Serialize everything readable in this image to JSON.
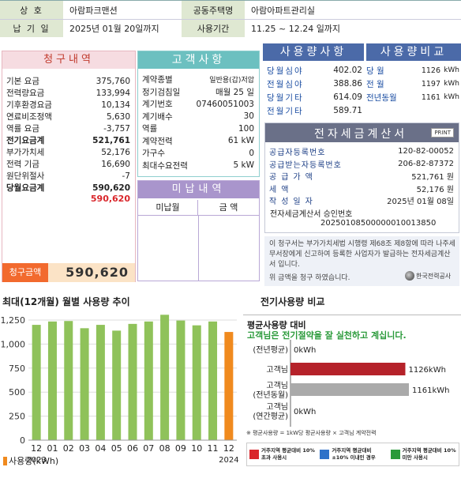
{
  "header": {
    "company_label": "상 호",
    "company_value": "아람파크맨션",
    "housing_label": "공동주택명",
    "housing_value": "아람아파트관리실",
    "due_label": "납 기 일",
    "due_value": "2025년 01월 20일까지",
    "period_label": "사용기간",
    "period_value": "11.25 ~ 12.24 일까지"
  },
  "billing": {
    "title": "청구내역",
    "rows": [
      {
        "label": "기본 요금",
        "value": "375,760"
      },
      {
        "label": "전력량요금",
        "value": "133,994"
      },
      {
        "label": "기후환경요금",
        "value": "10,134"
      },
      {
        "label": "연료비조정액",
        "value": "5,630"
      },
      {
        "label": "역률 요금",
        "value": "-3,757"
      },
      {
        "label": "전기요금계",
        "value": "521,761"
      },
      {
        "label": "부가가치세",
        "value": "52,176"
      },
      {
        "label": "전력 기금",
        "value": "16,690"
      },
      {
        "label": "원단위절사",
        "value": "-7"
      },
      {
        "label": "당월요금계",
        "value": "590,620"
      }
    ],
    "total_red": "590,620",
    "claim_label": "청구금액",
    "claim_value": "590,620"
  },
  "customer": {
    "title": "고객사항",
    "rows": [
      {
        "label": "계약종별",
        "value": "일반용(갑)저압"
      },
      {
        "label": "정기검침일",
        "value": "매월 25 일"
      },
      {
        "label": "계기번호",
        "value": "07460051003"
      },
      {
        "label": "계기배수",
        "value": "30"
      },
      {
        "label": "역률",
        "value": "100"
      },
      {
        "label": "계약전력",
        "value": "61 kW"
      },
      {
        "label": "가구수",
        "value": "0"
      },
      {
        "label": "최대수요전력",
        "value": "5 kW"
      }
    ],
    "unpaid_title": "미납내역",
    "unpaid_col1": "미납월",
    "unpaid_col2": "금 액"
  },
  "usage": {
    "title": "사용량사항",
    "rows": [
      {
        "label": "당월심야",
        "value": "402.02"
      },
      {
        "label": "전월심야",
        "value": "388.86"
      },
      {
        "label": "당월기타",
        "value": "614.09"
      },
      {
        "label": "전월기타",
        "value": "589.71"
      }
    ]
  },
  "compare": {
    "title": "사용량비교",
    "rows": [
      {
        "label": "당 월",
        "value": "1126",
        "unit": "kWh"
      },
      {
        "label": "전 월",
        "value": "1197",
        "unit": "kWh"
      },
      {
        "label": "전년동월",
        "value": "1161",
        "unit": "kWh"
      }
    ]
  },
  "invoice": {
    "title": "전자세금계산서",
    "print": "PRINT",
    "rows": [
      {
        "label": "공급자등록번호",
        "value": "120-82-00052"
      },
      {
        "label": "공급받는자등록번호",
        "value": "206-82-87372"
      },
      {
        "label": "공급가액",
        "value": "521,761 원"
      },
      {
        "label": "세액",
        "value": "52,176 원"
      },
      {
        "label": "작성일자",
        "value": "2025년 01월 08일"
      }
    ],
    "approval_label": "전자세금계산서 승인번호",
    "approval_value": "20250108500000010013850",
    "notice": "이 청구서는 부가가치세법 시행령 제68조 제8항에 따라 나주세무서장에게 신고하여 등록한 사업자가 발급하는 전자세금계산서 입니다.",
    "notice2": "위 금액을 청구 하였습니다.",
    "kepco": "한국전력공사"
  },
  "monthly_chart": {
    "title": "최대(12개월) 월별 사용량 추이",
    "legend": "사용량(kWh)",
    "year_labels": [
      "2023",
      "2024"
    ]
  },
  "comparison_chart": {
    "title": "전기사용량 비교",
    "subtitle": "평균사용량 대비",
    "message": "고객님은 전기절약을 잘 실천하고 계십니다.",
    "footnote": "※ 평균사용량 = 1kW당 평균사용량 × 고객님 계약전력",
    "legend": [
      {
        "label": "거주지역 평균대비 10% 초과 사용시",
        "color": "#d9262b"
      },
      {
        "label": "거주지역 평균대비 ±10% 이내인 경우",
        "color": "#2e72c9"
      },
      {
        "label": "거주지역 평균대비 10% 미만 사용시",
        "color": "#2a9a3a"
      }
    ]
  },
  "chart_data": [
    {
      "type": "bar",
      "categories": [
        "12",
        "01",
        "02",
        "03",
        "04",
        "05",
        "06",
        "07",
        "08",
        "09",
        "10",
        "11",
        "12"
      ],
      "values": [
        1200,
        1235,
        1240,
        1165,
        1200,
        1140,
        1210,
        1235,
        1305,
        1245,
        1195,
        1235,
        1126
      ],
      "ylim": [
        0,
        1250
      ],
      "yticks": [
        0,
        250,
        500,
        750,
        1000,
        1250
      ],
      "ytick_labels": [
        "0",
        "250",
        "500",
        "750",
        "1,000",
        "1,250"
      ],
      "highlight_last": true
    },
    {
      "type": "bar",
      "orientation": "horizontal",
      "categories": [
        "(전년평균)",
        "고객님",
        "고객님\n(전년동월)",
        "고객님\n(연간평균)"
      ],
      "values": [
        0,
        1126,
        1161,
        0
      ],
      "value_labels": [
        "0kWh",
        "1126kWh",
        "1161kWh",
        "0kWh"
      ],
      "colors": [
        "#bbbbbb",
        "#b5222a",
        "#aaaaaa",
        "#bbbbbb"
      ]
    }
  ]
}
